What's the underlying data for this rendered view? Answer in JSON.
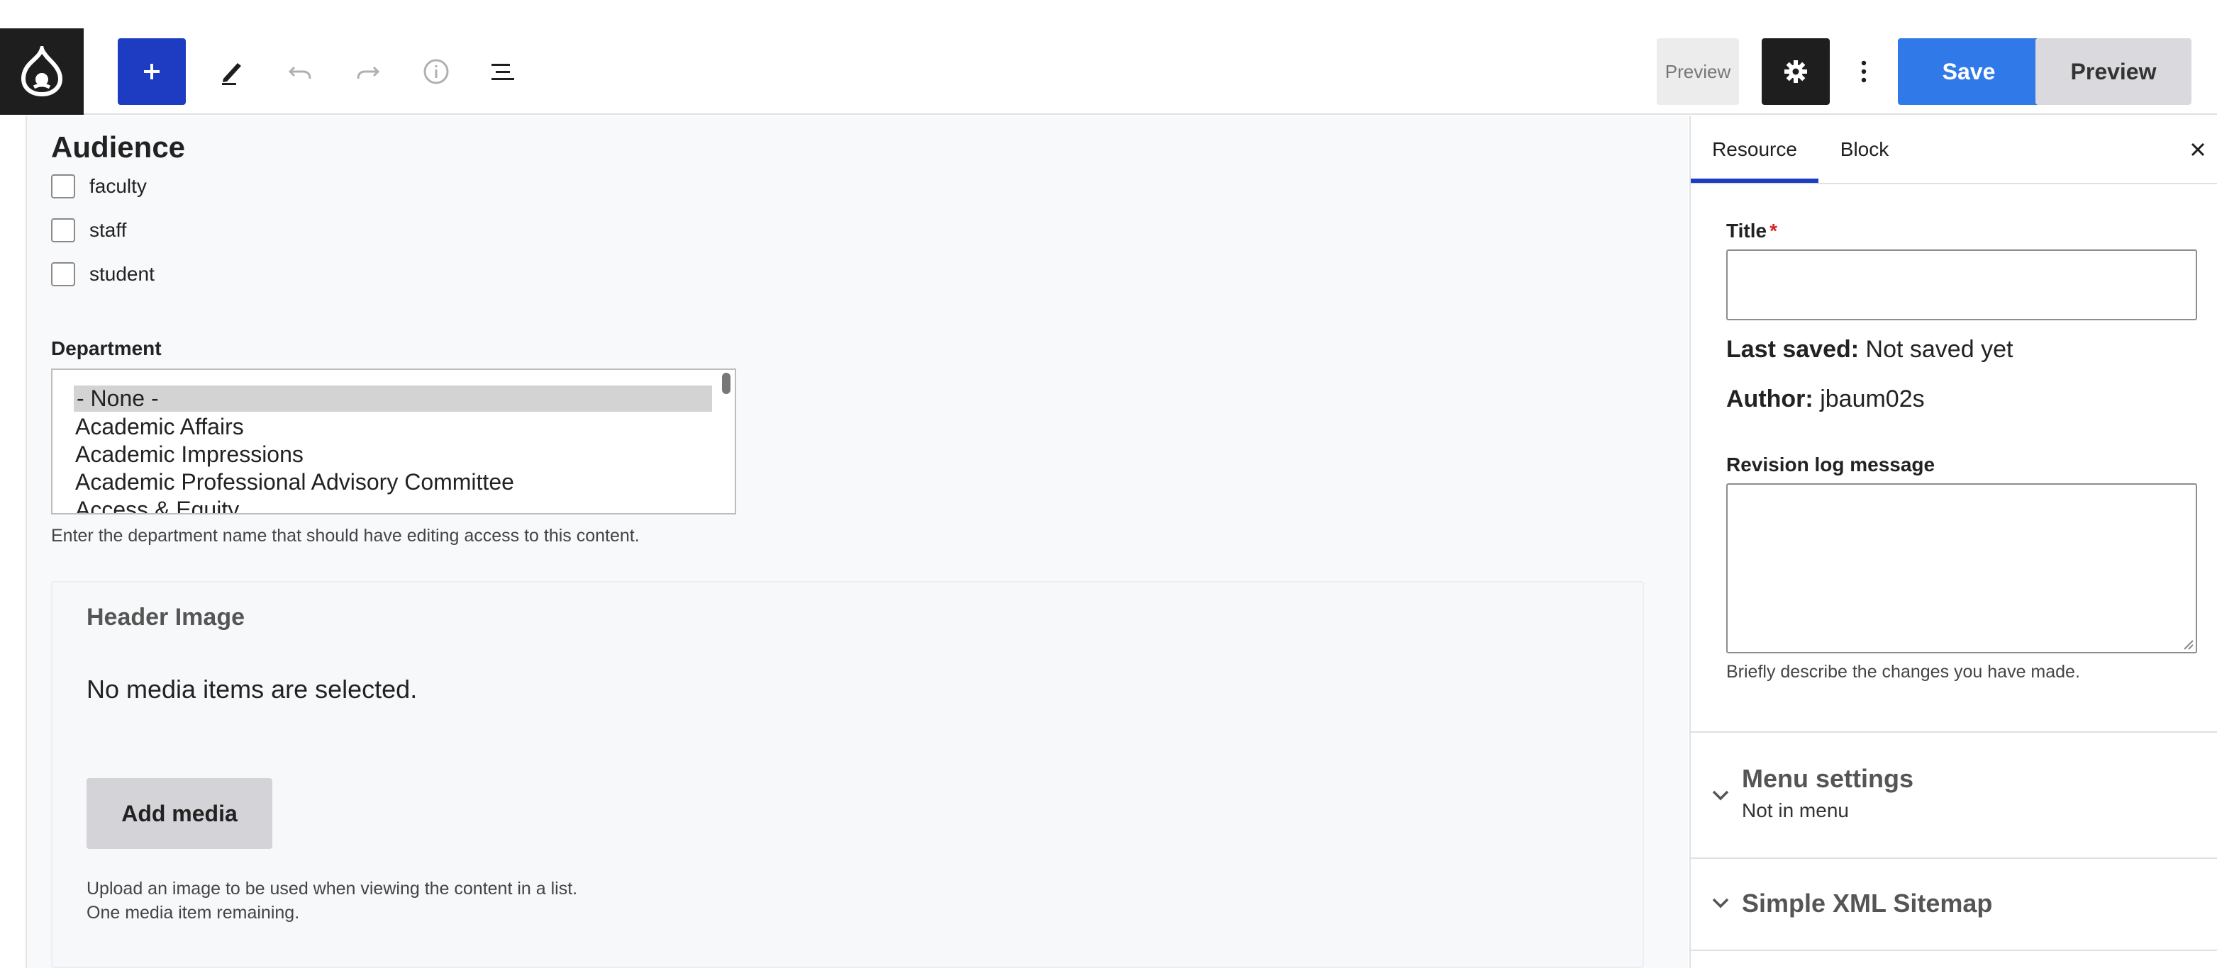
{
  "toolbar": {
    "preview_small_label": "Preview",
    "save_label": "Save",
    "preview_label": "Preview",
    "icons": {
      "logo": "drupal-logo-icon",
      "insert": "plus-icon",
      "tools": "pencil-icon",
      "undo": "undo-icon",
      "redo": "redo-icon",
      "details": "info-icon",
      "outline": "list-view-icon",
      "settings": "gear-icon",
      "options": "more-vertical-icon"
    },
    "colors": {
      "insert_bg": "#1d3cc2",
      "save_bg": "#2f79e8",
      "settings_bg": "#1e1e1e"
    }
  },
  "main": {
    "audience": {
      "heading": "Audience",
      "options": [
        {
          "label": "faculty",
          "checked": false
        },
        {
          "label": "staff",
          "checked": false
        },
        {
          "label": "student",
          "checked": false
        }
      ]
    },
    "department": {
      "label": "Department",
      "options": [
        "- None -",
        "Academic Affairs",
        "Academic Impressions",
        "Academic Professional Advisory Committee",
        "Access & Equity"
      ],
      "selected": "- None -",
      "help": "Enter the department name that should have editing access to this content."
    },
    "header_image": {
      "title": "Header Image",
      "empty_text": "No media items are selected.",
      "add_button": "Add media",
      "help_line1": "Upload an image to be used when viewing the content in a list.",
      "help_line2": "One media item remaining."
    }
  },
  "sidebar": {
    "tabs": [
      {
        "label": "Resource",
        "active": true
      },
      {
        "label": "Block",
        "active": false
      }
    ],
    "close_icon": "close-icon",
    "title_label": "Title",
    "required_mark": "*",
    "title_value": "",
    "last_saved_label": "Last saved:",
    "last_saved_value": "Not saved yet",
    "author_label": "Author:",
    "author_value": "jbaum02s",
    "revision_label": "Revision log message",
    "revision_value": "",
    "revision_help": "Briefly describe the changes you have made.",
    "panels": [
      {
        "title": "Menu settings",
        "subtitle": "Not in menu",
        "icon": "chevron-down-icon"
      },
      {
        "title": "Simple XML Sitemap",
        "subtitle": "",
        "icon": "chevron-down-icon"
      }
    ]
  }
}
